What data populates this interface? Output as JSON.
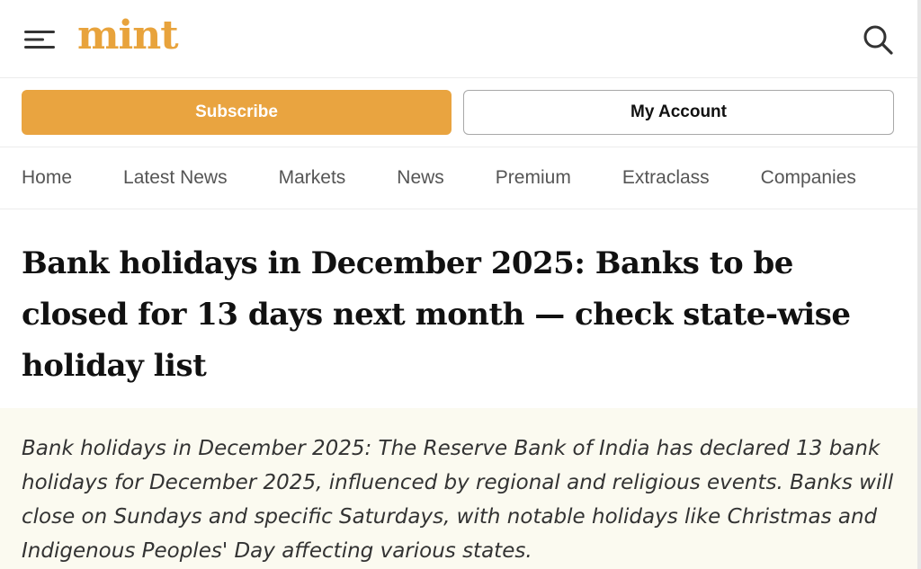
{
  "header": {
    "logo_text": "mint",
    "menu_icon": "hamburger-menu-icon",
    "search_icon": "search-icon",
    "brand_color": "#e8a33c"
  },
  "actions": {
    "subscribe_label": "Subscribe",
    "account_label": "My Account",
    "subscribe_color": "#e9a440"
  },
  "nav": {
    "items": [
      {
        "label": "Home"
      },
      {
        "label": "Latest News"
      },
      {
        "label": "Markets"
      },
      {
        "label": "News"
      },
      {
        "label": "Premium"
      },
      {
        "label": "Extraclass"
      },
      {
        "label": "Companies"
      }
    ]
  },
  "article": {
    "headline": "Bank holidays in December 2025: Banks to be closed for 13 days next month — check state-wise holiday list",
    "summary": "Bank holidays in December 2025: The Reserve Bank of India has declared 13 bank holidays for December 2025, influenced by regional and religious events. Banks will close on Sundays and specific Saturdays, with notable holidays like Christmas and Indigenous Peoples' Day affecting various states."
  }
}
